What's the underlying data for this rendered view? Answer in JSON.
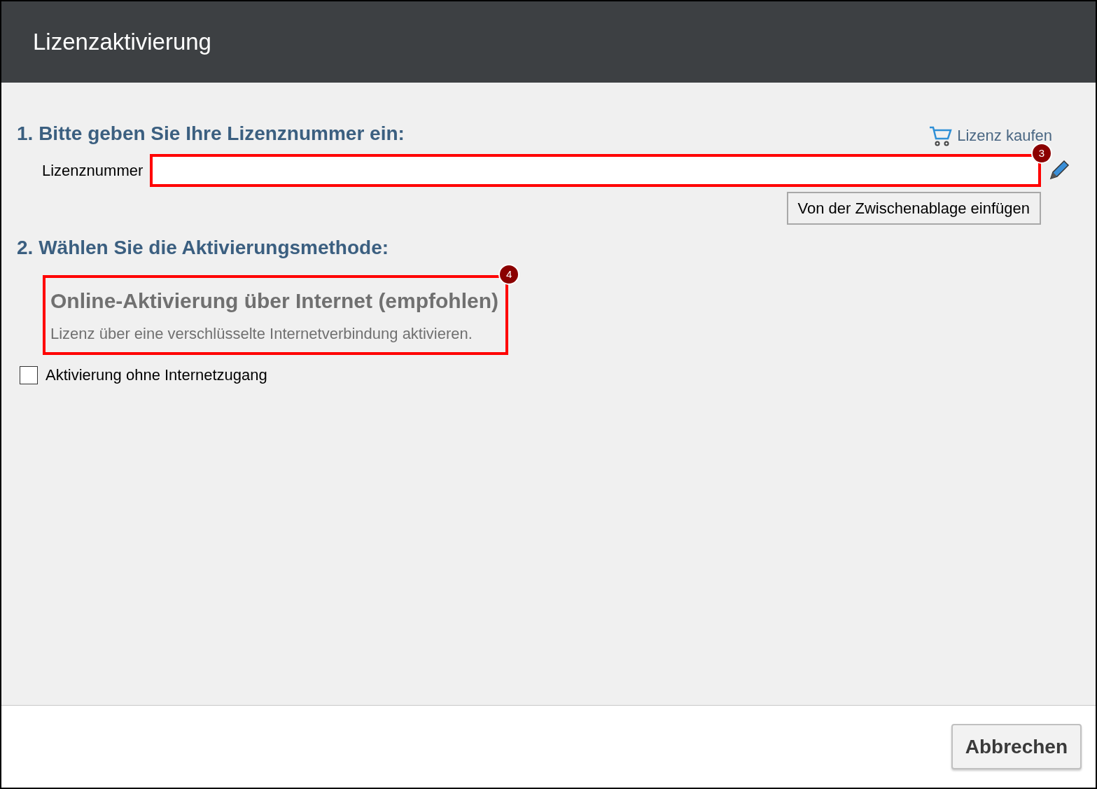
{
  "window": {
    "title": "Lizenzaktivierung"
  },
  "step1": {
    "heading": "1. Bitte geben Sie Ihre Lizenznummer ein:",
    "buy_link": "Lizenz kaufen",
    "field_label": "Lizenznummer",
    "field_callout": "3",
    "paste_button": "Von der Zwischenablage einfügen"
  },
  "step2": {
    "heading": "2. Wählen Sie die Aktivierungsmethode:",
    "option": {
      "title": "Online-Aktivierung über Internet (empfohlen)",
      "description": "Lizenz über eine verschlüsselte Internetverbindung aktivieren.",
      "callout": "4"
    },
    "offline": {
      "label": "Aktivierung ohne Internetzugang",
      "checked": false
    }
  },
  "footer": {
    "cancel_button": "Abbrechen"
  }
}
